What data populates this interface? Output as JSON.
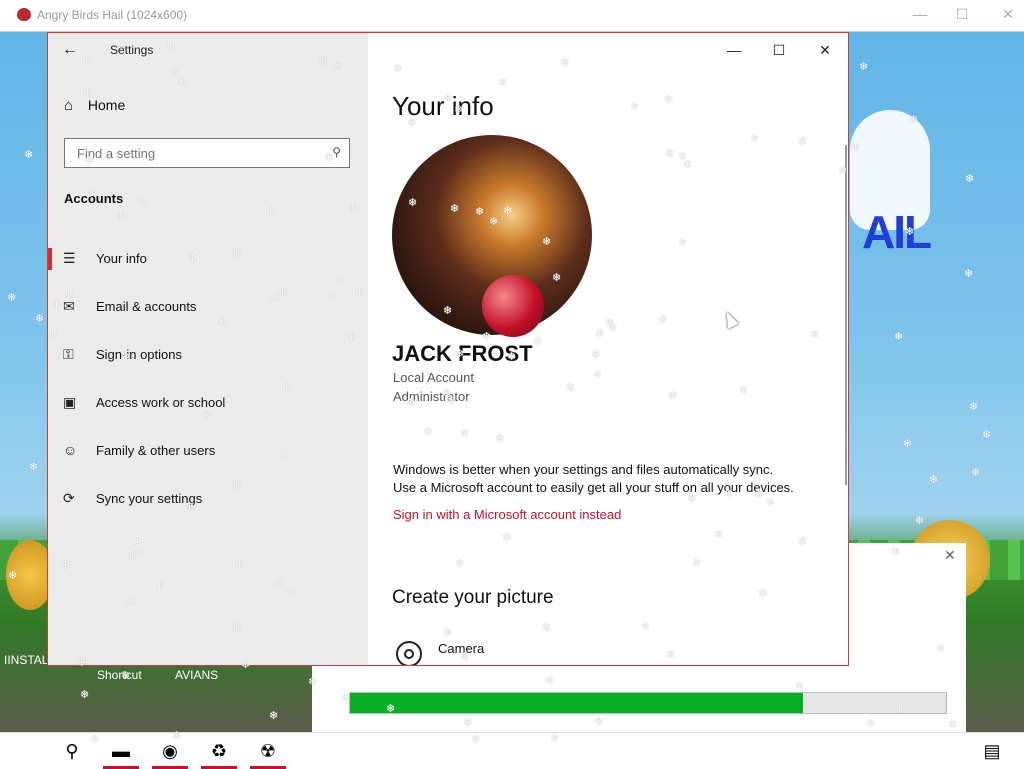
{
  "background_window": {
    "title": "Angry Birds Hail (1024x600)",
    "controls": {
      "minimize": "—",
      "maximize": "☐",
      "close": "✕"
    },
    "logo_text": "AIL",
    "desktop_icons": [
      "IINSTAL",
      "Shortcut",
      "AVIANS"
    ]
  },
  "settings": {
    "app_title": "Settings",
    "back_glyph": "←",
    "home_label": "Home",
    "home_glyph": "⌂",
    "search": {
      "placeholder": "Find a setting",
      "value": ""
    },
    "section_title": "Accounts",
    "nav": [
      {
        "label": "Your info",
        "icon": "person-card-icon",
        "glyph": "☰",
        "selected": true
      },
      {
        "label": "Email & accounts",
        "icon": "mail-icon",
        "glyph": "✉",
        "selected": false
      },
      {
        "label": "Sign-in options",
        "icon": "key-icon",
        "glyph": "⚿",
        "selected": false
      },
      {
        "label": "Access work or school",
        "icon": "briefcase-icon",
        "glyph": "▣",
        "selected": false
      },
      {
        "label": "Family & other users",
        "icon": "person-add-icon",
        "glyph": "☺",
        "selected": false
      },
      {
        "label": "Sync your settings",
        "icon": "sync-icon",
        "glyph": "⟳",
        "selected": false
      }
    ],
    "window_controls": {
      "minimize": "—",
      "maximize": "☐",
      "close": "✕"
    },
    "content": {
      "title": "Your info",
      "name": "JACK FROST",
      "account_type": "Local Account",
      "role": "Administrator",
      "sync_line1": "Windows is better when your settings and files automatically sync.",
      "sync_line2": "Use a Microsoft account to easily get all your stuff on all your devices.",
      "ms_link": "Sign in with a Microsoft account instead",
      "create_picture_title": "Create your picture",
      "camera_label": "Camera"
    }
  },
  "progress_dialog": {
    "close_glyph": "✕",
    "progress_fraction": 0.76,
    "bar_color": "#06b025"
  },
  "taskbar": {
    "items": [
      {
        "name": "start-button",
        "icon": "windows-logo-icon",
        "glyph": ""
      },
      {
        "name": "search-button",
        "icon": "search-icon",
        "glyph": "⚲"
      },
      {
        "name": "file-explorer-button",
        "icon": "folder-icon",
        "glyph": "▬"
      },
      {
        "name": "firefox-button",
        "icon": "firefox-icon",
        "glyph": "◉"
      },
      {
        "name": "app-button",
        "icon": "recycle-icon",
        "glyph": "♻"
      },
      {
        "name": "hazard-app-button",
        "icon": "radiation-icon",
        "glyph": "☢"
      }
    ],
    "notification_glyph": "▤"
  },
  "colors": {
    "accent": "#c8102e",
    "selected_marker": "#d32f2f"
  }
}
